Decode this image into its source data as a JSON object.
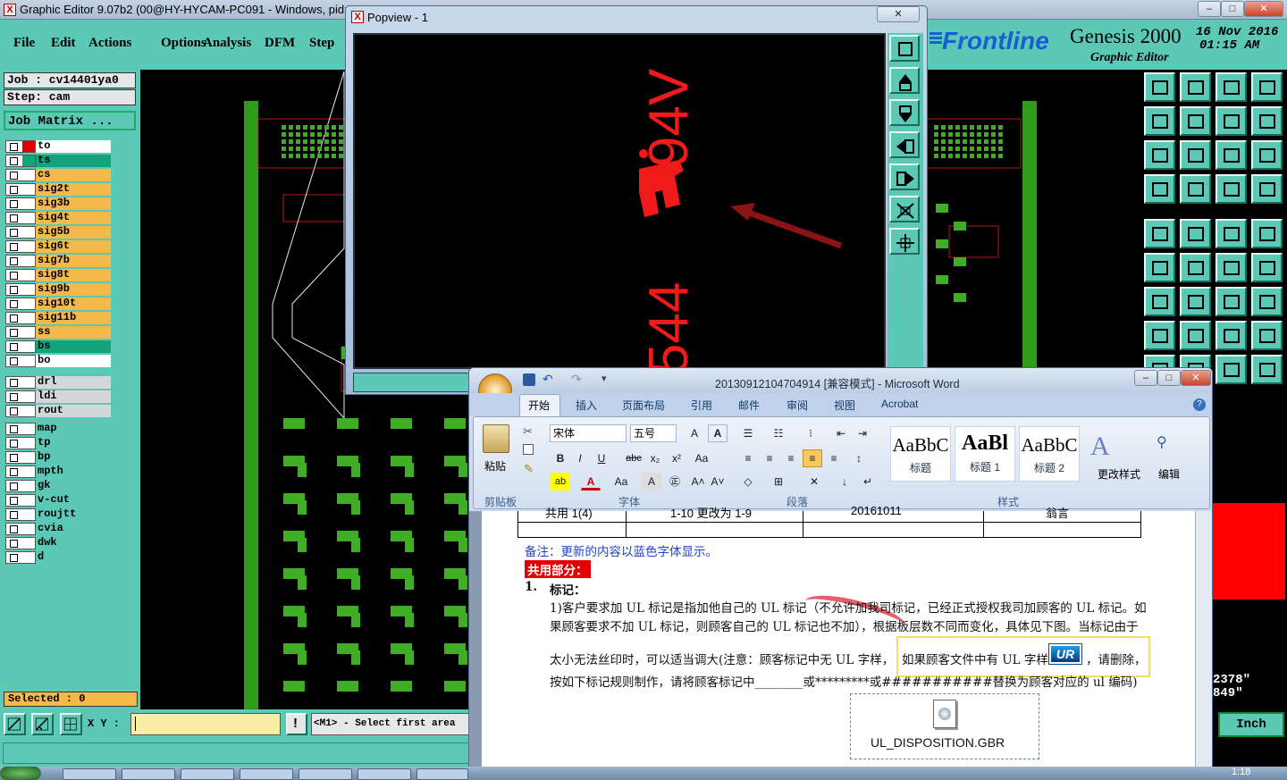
{
  "main_window": {
    "title": "Graphic Editor 9.07b2 (00@HY-HYCAM-PC091 - Windows, pid:",
    "app_icon_letter": "X"
  },
  "menu": {
    "items": [
      "File",
      "Edit",
      "Actions",
      "Options",
      "Analysis",
      "DFM",
      "Step"
    ]
  },
  "branding": {
    "logo": "Frontline",
    "product": "Genesis 2000",
    "subtitle": "Graphic Editor",
    "date": "16 Nov 2016",
    "time": "01:15 AM"
  },
  "job_panel": {
    "job": "Job : cv14401ya0",
    "step": "Step: cam",
    "job_matrix": "Job Matrix ..."
  },
  "layers": [
    {
      "name": "to",
      "color": "#ffffff",
      "status": "#e00000"
    },
    {
      "name": "ts",
      "color": "#13a37a",
      "status": "#13a37a"
    },
    {
      "name": "cs",
      "color": "#f3b94a"
    },
    {
      "name": "sig2t",
      "color": "#f3b94a"
    },
    {
      "name": "sig3b",
      "color": "#f3b94a"
    },
    {
      "name": "sig4t",
      "color": "#f3b94a"
    },
    {
      "name": "sig5b",
      "color": "#f3b94a"
    },
    {
      "name": "sig6t",
      "color": "#f3b94a"
    },
    {
      "name": "sig7b",
      "color": "#f3b94a"
    },
    {
      "name": "sig8t",
      "color": "#f3b94a"
    },
    {
      "name": "sig9b",
      "color": "#f3b94a"
    },
    {
      "name": "sig10t",
      "color": "#f3b94a"
    },
    {
      "name": "sig11b",
      "color": "#f3b94a"
    },
    {
      "name": "ss",
      "color": "#f3b94a"
    },
    {
      "name": "bs",
      "color": "#13a37a"
    },
    {
      "name": "bo",
      "color": "#ffffff"
    }
  ],
  "drill_layers": [
    {
      "name": "drl",
      "color": "#d4d7da"
    },
    {
      "name": "ldi",
      "color": "#d4d7da"
    },
    {
      "name": "rout",
      "color": "#d4d7da"
    }
  ],
  "doc_layers": [
    {
      "name": "map",
      "color": "#5cc9b6"
    },
    {
      "name": "tp",
      "color": "#5cc9b6"
    },
    {
      "name": "bp",
      "color": "#5cc9b6"
    },
    {
      "name": "mpth",
      "color": "#5cc9b6"
    },
    {
      "name": "gk",
      "color": "#5cc9b6"
    },
    {
      "name": "v-cut",
      "color": "#5cc9b6"
    },
    {
      "name": "roujtt",
      "color": "#5cc9b6"
    },
    {
      "name": "cvia",
      "color": "#5cc9b6"
    },
    {
      "name": "dwk",
      "color": "#5cc9b6"
    },
    {
      "name": "d",
      "color": "#5cc9b6"
    }
  ],
  "status": {
    "selected": "Selected : 0",
    "xy_label": "X Y :",
    "prompt": "<M1> - Select first area",
    "coord_x": "2378\"",
    "coord_y": "849\"",
    "units": "Inch"
  },
  "popview": {
    "title": "Popview - 1",
    "text_94v": "94V",
    "text_544": "544"
  },
  "word": {
    "title": "20130912104704914 [兼容模式] - Microsoft Word",
    "tabs": [
      "开始",
      "插入",
      "页面布局",
      "引用",
      "邮件",
      "审阅",
      "视图",
      "Acrobat"
    ],
    "font_name": "宋体",
    "font_size": "五号",
    "groups": [
      "剪贴板",
      "字体",
      "段落",
      "样式"
    ],
    "paste_label": "粘贴",
    "styles": [
      {
        "preview": "AaBbC",
        "label": "标题"
      },
      {
        "preview": "AaBl",
        "label": "标题 1"
      },
      {
        "preview": "AaBbC",
        "label": "标题 2"
      }
    ],
    "change_styles": "更改样式",
    "editing": "编辑",
    "table_row": [
      "共用 1(4)",
      "1-10 更改为 1-9",
      "20161011",
      "翁言"
    ],
    "note": "备注：更新的内容以蓝色字体显示。",
    "section_heading": "共用部分：",
    "item_num": "1.",
    "item_heading": "标记：",
    "line1": "1)客户要求加 UL 标记是指加他自己的 UL 标记（不允许加我司标记，已经正式授权我司加顾客的 UL 标记。如",
    "line2": "果顾客要求不加 UL 标记，则顾客自己的 UL 标记也不加），根据板层数不同而变化，具体见下图。当标记由于",
    "line3a": "太小无法丝印时，可以适当调大(注意：顾客标记中无 UL 字样，",
    "line3b": "如果顾客文件中有 UL 字样",
    "line3c": "，请删除，",
    "line4": "按如下标记规则制作，请将顾客标记中________或*********或###########替换为顾客对应的 ul 编码)",
    "attachment": "UL_DISPOSITION.GBR"
  },
  "taskbar": {
    "clock": "1:18"
  }
}
